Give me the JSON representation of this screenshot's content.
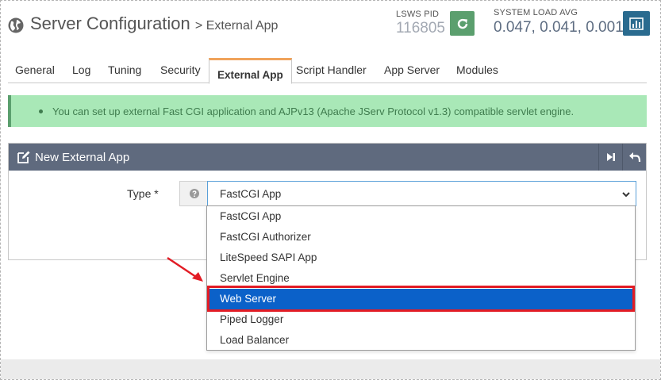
{
  "header": {
    "title": "Server Configuration",
    "breadcrumb": "> External App",
    "pid_label": "LSWS PID",
    "pid_value": "116805",
    "load_label": "SYSTEM LOAD AVG",
    "load_value": "0.047, 0.041, 0.001",
    "icons": [
      "globe-icon",
      "refresh-icon",
      "bar-chart-icon"
    ]
  },
  "tabs": [
    {
      "label": "General"
    },
    {
      "label": "Log"
    },
    {
      "label": "Tuning"
    },
    {
      "label": "Security"
    },
    {
      "label": "External App",
      "active": true
    },
    {
      "label": "Script Handler"
    },
    {
      "label": "App Server"
    },
    {
      "label": "Modules"
    }
  ],
  "alert": {
    "text": "You can set up external Fast CGI application and AJPv13 (Apache JServ Protocol v1.3) compatible servlet engine."
  },
  "panel": {
    "title": "New External App",
    "icons": [
      "edit-icon",
      "next-icon",
      "back-icon"
    ],
    "type_label": "Type *",
    "type_value": "FastCGI App"
  },
  "dropdown": {
    "options": [
      "FastCGI App",
      "FastCGI Authorizer",
      "LiteSpeed SAPI App",
      "Servlet Engine",
      "Web Server",
      "Piped Logger",
      "Load Balancer"
    ],
    "highlighted": "Web Server"
  },
  "colors": {
    "alert_bg": "#a9e8b7",
    "panel_header": "#5f6a7e",
    "tab_accent": "#f0a35b",
    "selection": "#0b61c9",
    "annotation": "#e21c25"
  }
}
